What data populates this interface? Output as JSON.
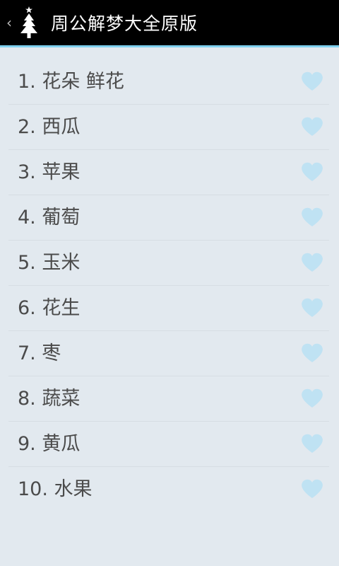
{
  "header": {
    "back_glyph": "‹",
    "app_icon": "christmas-tree-icon",
    "title": "周公解梦大全原版"
  },
  "items": [
    {
      "label": "1.  花朵 鲜花",
      "icon": "heart-icon"
    },
    {
      "label": "2.  西瓜",
      "icon": "heart-icon"
    },
    {
      "label": "3.  苹果",
      "icon": "heart-icon"
    },
    {
      "label": "4.  葡萄",
      "icon": "heart-icon"
    },
    {
      "label": "5.  玉米",
      "icon": "heart-icon"
    },
    {
      "label": "6.  花生",
      "icon": "heart-icon"
    },
    {
      "label": "7.  枣",
      "icon": "heart-icon"
    },
    {
      "label": "8.  蔬菜",
      "icon": "heart-icon"
    },
    {
      "label": "9.  黄瓜",
      "icon": "heart-icon"
    },
    {
      "label": "10.  水果",
      "icon": "heart-icon"
    }
  ],
  "colors": {
    "action_bar": "#000000",
    "accent_line": "#7fd0ee",
    "background": "#e2e9ef",
    "heart": "#bfe2f3",
    "text": "#4b4b4b"
  }
}
